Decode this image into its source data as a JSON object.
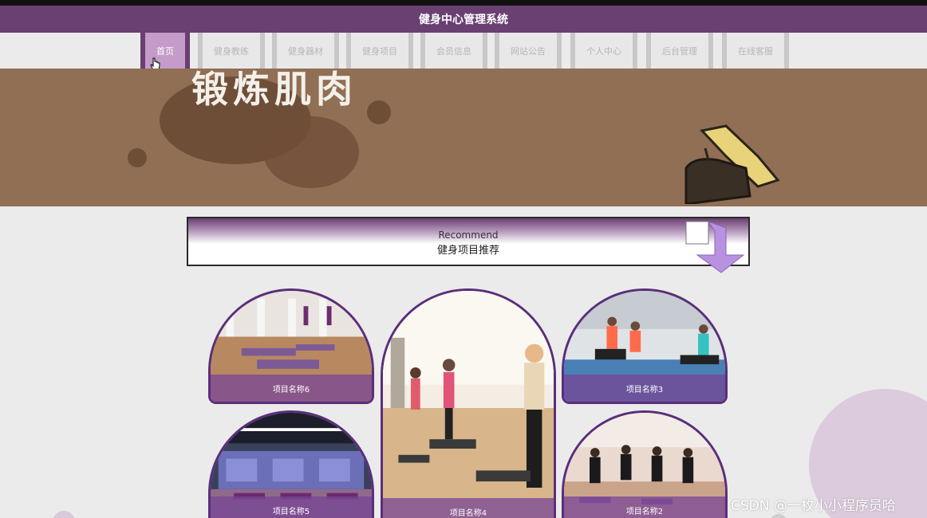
{
  "header": {
    "title": "健身中心管理系统"
  },
  "nav": {
    "items": [
      {
        "label": "首页",
        "active": true
      },
      {
        "label": "健身教练"
      },
      {
        "label": "健身器材"
      },
      {
        "label": "健身项目"
      },
      {
        "label": "会员信息"
      },
      {
        "label": "网站公告"
      },
      {
        "label": "个人中心"
      },
      {
        "label": "后台管理"
      },
      {
        "label": "在线客服"
      }
    ]
  },
  "banner": {
    "text": "锻炼肌肉"
  },
  "recommend": {
    "title_en": "Recommend",
    "title_cn": "健身项目推荐"
  },
  "cards": [
    {
      "label": "项目名称6"
    },
    {
      "label": "项目名称4"
    },
    {
      "label": "项目名称3"
    },
    {
      "label": "项目名称5"
    },
    {
      "label": "项目名称2"
    }
  ],
  "watermark": "CSDN @一枚小小程序员哈",
  "colors": {
    "primary": "#6a3f72",
    "active_tab": "#c49bc9",
    "banner": "#906f55"
  }
}
